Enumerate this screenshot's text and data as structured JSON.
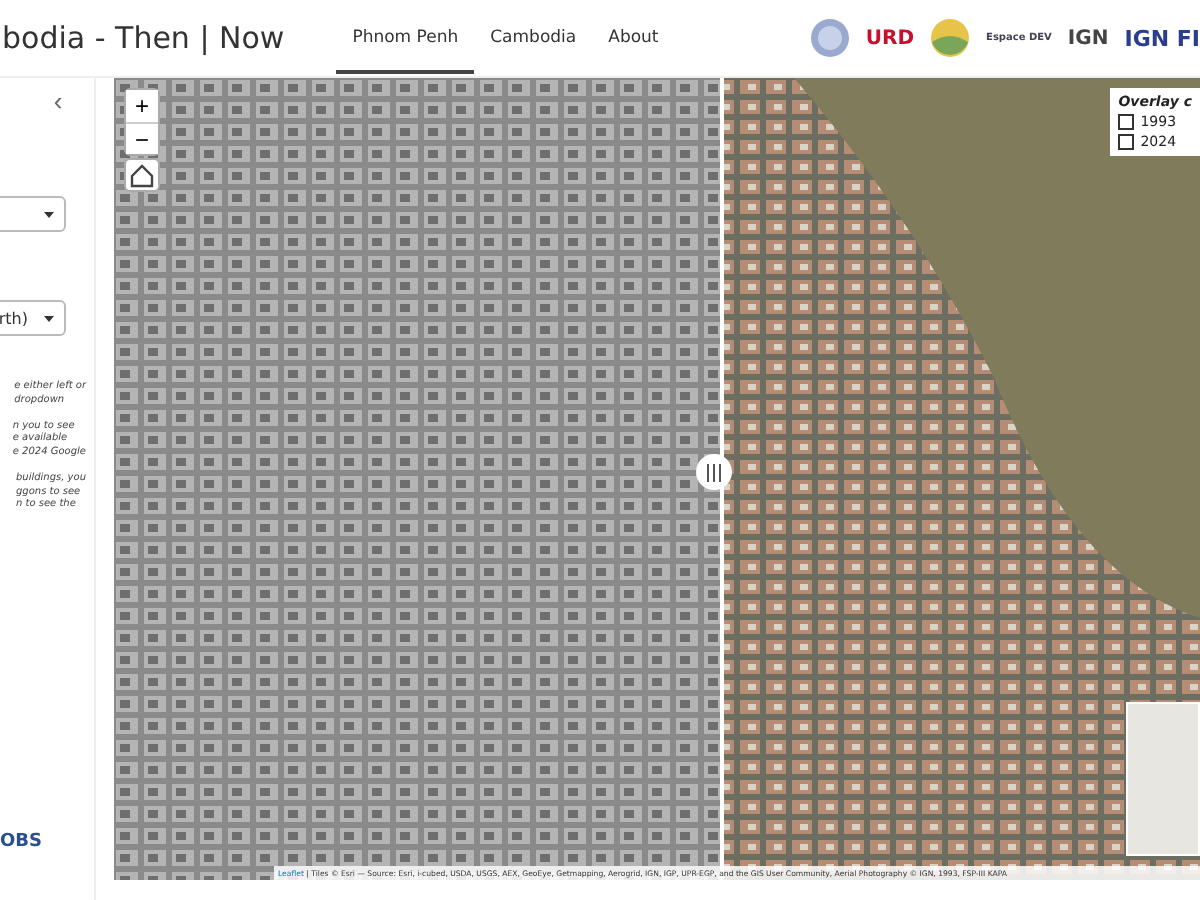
{
  "header": {
    "title": "bodia - Then | Now",
    "tabs": [
      {
        "label": "Phnom Penh",
        "selected": true
      },
      {
        "label": "Cambodia",
        "selected": false
      },
      {
        "label": "About",
        "selected": false
      }
    ],
    "logos": [
      {
        "kind": "seal"
      },
      {
        "kind": "text",
        "label": "URD"
      },
      {
        "kind": "sun"
      },
      {
        "kind": "text",
        "label": "Espace DEV"
      },
      {
        "kind": "text",
        "label": "IGN"
      },
      {
        "kind": "text",
        "label": "IGN FI"
      }
    ]
  },
  "sidebar": {
    "collapse": "‹",
    "selects": [
      {
        "kind": "empty"
      },
      {
        "kind": "value",
        "value": "rth)"
      }
    ],
    "paragraphs": [
      [
        "e either left or",
        "dropdown"
      ],
      [
        "n you to see",
        "e available",
        "e 2024 Google"
      ],
      [
        "buildings, you",
        "ggons to see",
        "n to see the"
      ]
    ],
    "footer_logo": "OBS"
  },
  "map": {
    "zoom_in": "+",
    "zoom_out": "−",
    "overlay": {
      "title": "Overlay c",
      "options": [
        {
          "label": "1993",
          "checked": false
        },
        {
          "label": "2024",
          "checked": false
        }
      ]
    },
    "attribution_link": "Leaflet",
    "attribution": "| Tiles © Esri — Source: Esri, i-cubed, USDA, USGS, AEX, GeoEye, Getmapping, Aerogrid, IGN, IGP, UPR-EGP, and the GIS User Community, Aerial Photography © IGN, 1993, FSP-III KAPA"
  }
}
